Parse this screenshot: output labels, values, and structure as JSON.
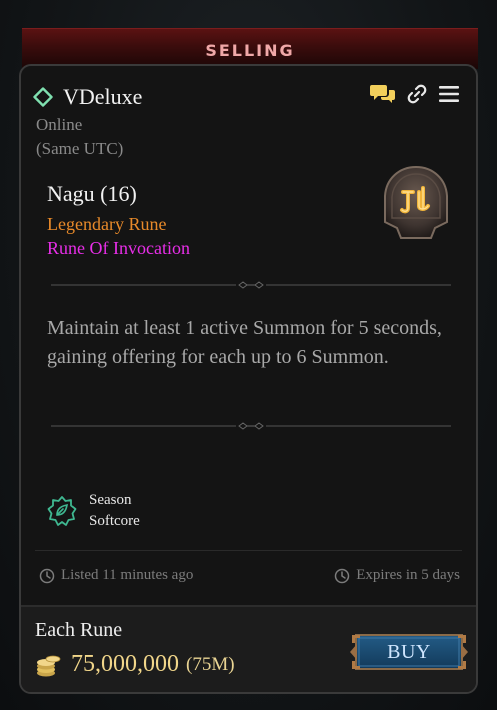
{
  "banner": {
    "label": "SELLING"
  },
  "seller": {
    "name": "VDeluxe",
    "status": "Online",
    "timezone": "(Same UTC)"
  },
  "icons": {
    "online": "online-status-icon",
    "chat": "chat-icon",
    "link": "link-icon",
    "menu": "menu-icon",
    "rune": "rune-icon",
    "season": "season-icon",
    "clock": "clock-icon",
    "gold": "gold-coins-icon"
  },
  "item": {
    "name": "Nagu (16)",
    "rarity": "Legendary Rune",
    "type": "Rune Of Invocation",
    "description": "Maintain at least 1 active Summon for 5 seconds, gaining offering for each up to 6 Summon."
  },
  "mode": {
    "line1": "Season",
    "line2": "Softcore"
  },
  "listing": {
    "listed": "Listed 11 minutes ago",
    "expires": "Expires in 5 days"
  },
  "price": {
    "label": "Each Rune",
    "value": "75,000,000",
    "short": "(75M)"
  },
  "buy": {
    "label": "BUY"
  },
  "colors": {
    "rarity": "#e88a2a",
    "type": "#e82ee8",
    "online": "#7fe0b0",
    "gold": "#f1d68a",
    "banner": "#5a1212",
    "buy": "#1a4f7a"
  }
}
